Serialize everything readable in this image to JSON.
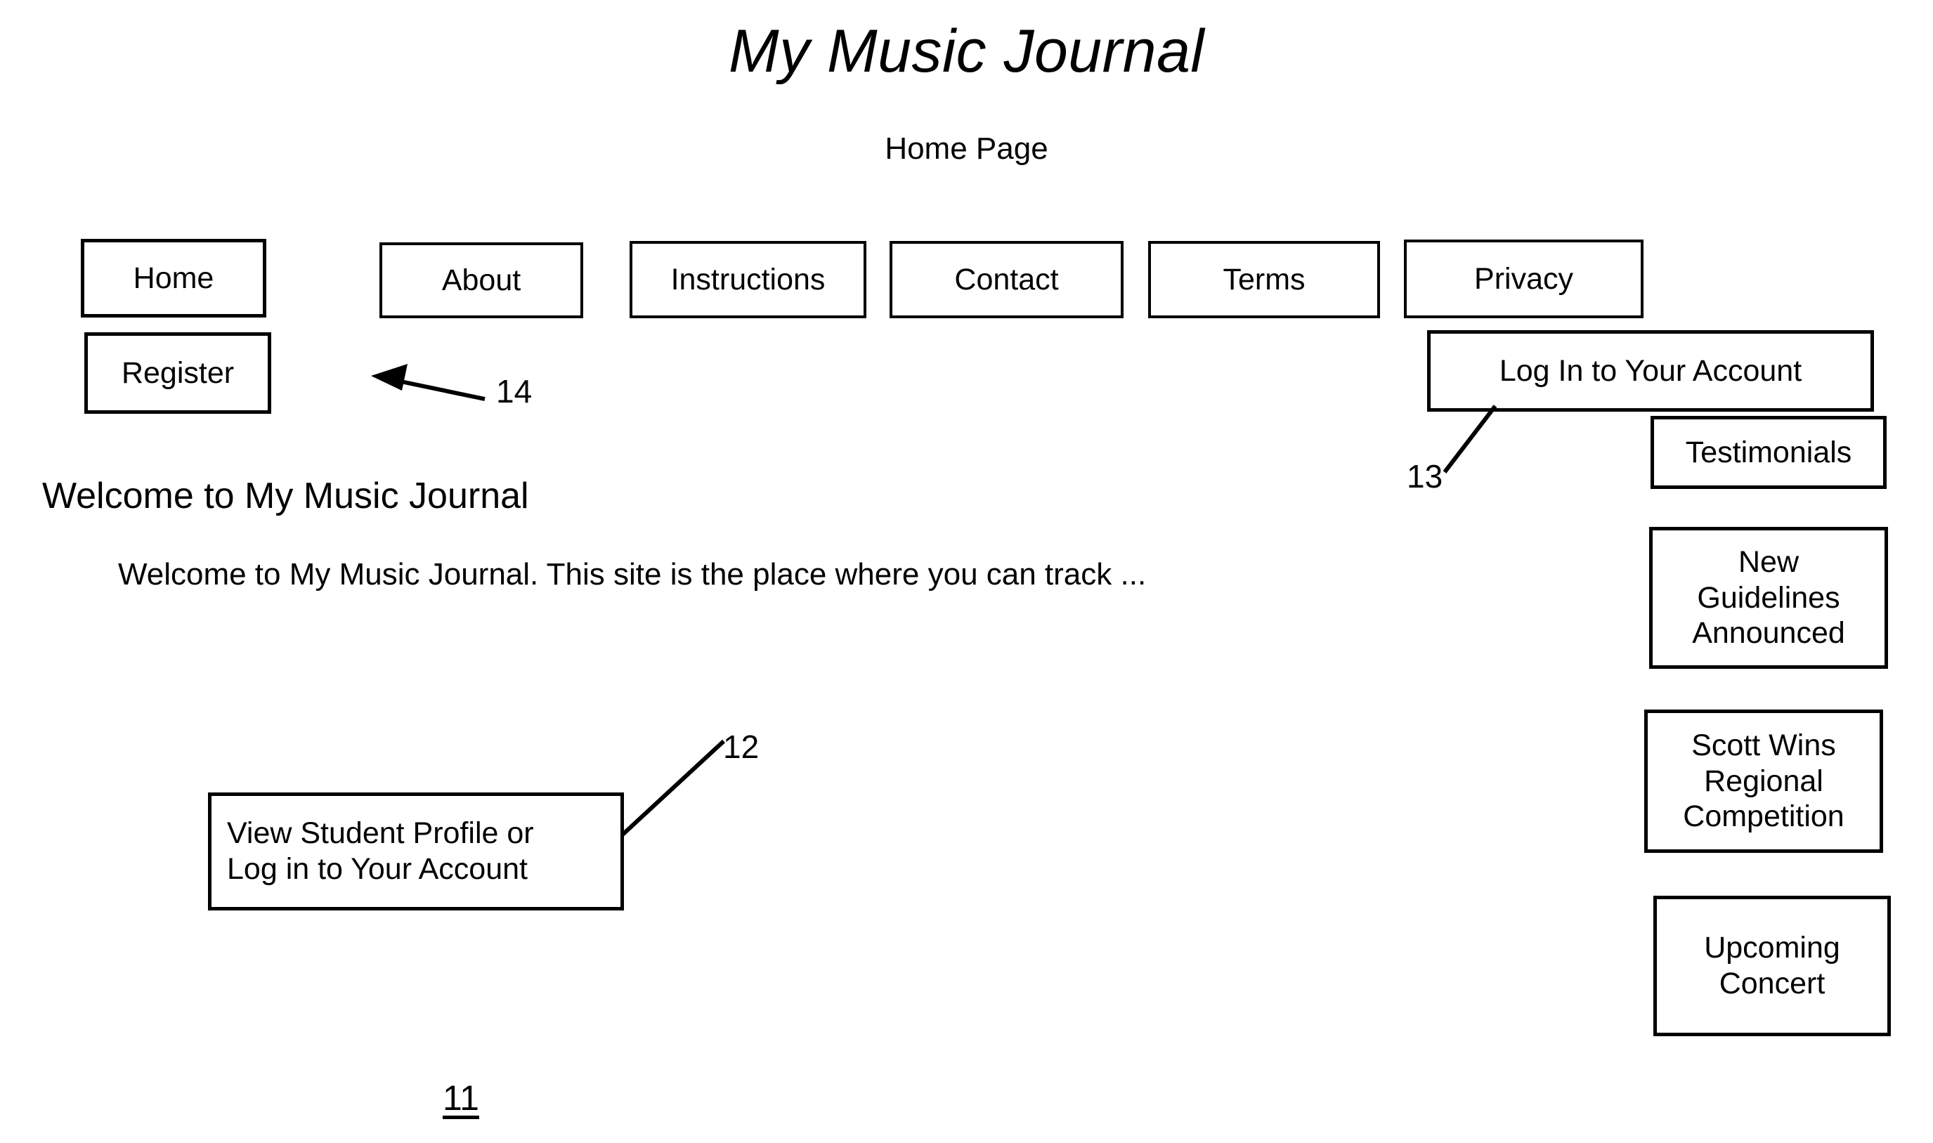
{
  "figure": {
    "title": "My Music Journal",
    "subtitle": "Home Page",
    "figure_number": "11"
  },
  "nav": {
    "items": [
      {
        "label": "Home"
      },
      {
        "label": "About"
      },
      {
        "label": "Instructions"
      },
      {
        "label": "Contact"
      },
      {
        "label": "Terms"
      },
      {
        "label": "Privacy"
      },
      {
        "label": "Register"
      }
    ]
  },
  "main": {
    "heading": "Welcome to My Music Journal",
    "paragraph": "Welcome to My Music Journal. This site is the place where you can track ...",
    "cta": {
      "line1": "View Student Profile or",
      "line2": "Log in to Your Account"
    }
  },
  "sidebar": {
    "login_button": "Log In to Your Account",
    "panels": [
      {
        "lines": [
          "Testimonials"
        ]
      },
      {
        "lines": [
          "New",
          "Guidelines",
          "Announced"
        ]
      },
      {
        "lines": [
          "Scott Wins",
          "Regional",
          "Competition"
        ]
      },
      {
        "lines": [
          "Upcoming",
          "Concert"
        ]
      }
    ]
  },
  "callouts": [
    {
      "id": "cta-callout",
      "number": "12"
    },
    {
      "id": "login-callout",
      "number": "13"
    },
    {
      "id": "register-callout",
      "number": "14"
    }
  ],
  "colors": {
    "ink": "#000000",
    "paper": "#ffffff"
  }
}
